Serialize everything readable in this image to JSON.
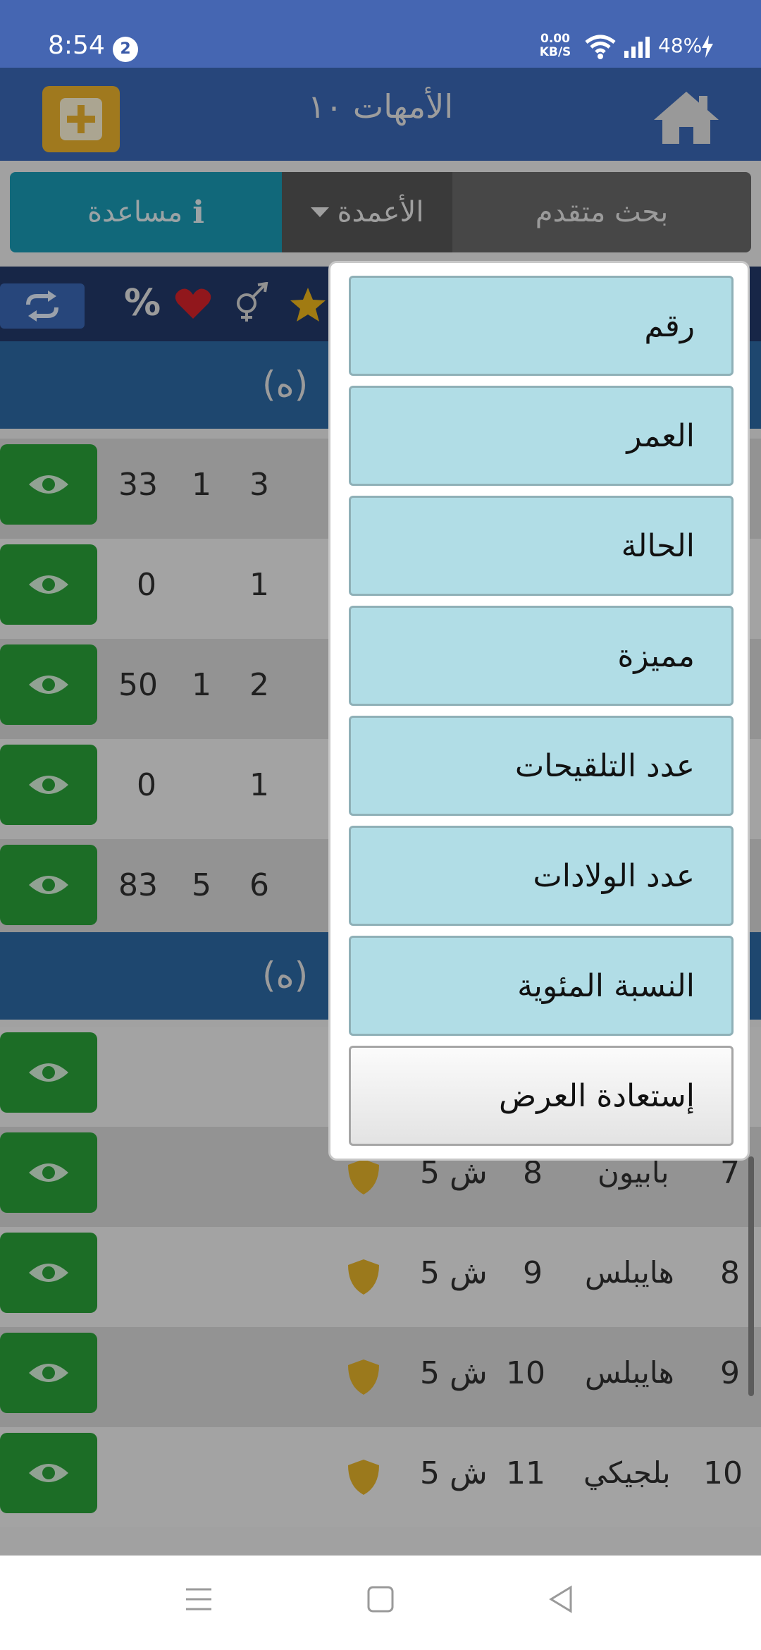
{
  "status_bar": {
    "time": "8:54",
    "notification_count": "2",
    "net_speed_value": "0.00",
    "net_speed_unit": "KB/S",
    "battery": "48%"
  },
  "app_bar": {
    "title": "الأمهات ١٠",
    "brand_color": "#3b69b8",
    "add_button_color": "#efb52e"
  },
  "toolbar": {
    "help_label": "مساعدة",
    "columns_label": "الأعمدة",
    "advanced_search_label": "بحث متقدم"
  },
  "filter_icons": [
    "refresh-icon",
    "percent-icon",
    "heart-icon",
    "gender-icon",
    "star-icon"
  ],
  "filter_labels": {
    "percent": "%"
  },
  "groups": [
    {
      "label": "(ه)"
    },
    {
      "label": "(ه)"
    }
  ],
  "rows_group1": [
    {
      "c1": "33",
      "c2": "1",
      "c3": "3"
    },
    {
      "c1": "0",
      "c2": "",
      "c3": "1"
    },
    {
      "c1": "50",
      "c2": "1",
      "c3": "2"
    },
    {
      "c1": "0",
      "c2": "",
      "c3": "1"
    },
    {
      "c1": "83",
      "c2": "5",
      "c3": "6"
    }
  ],
  "rows_group2": [
    {
      "num": "",
      "name": "",
      "age": "",
      "status": ""
    },
    {
      "num": "7",
      "name": "بابيون",
      "age": "8",
      "status": "5 ش"
    },
    {
      "num": "8",
      "name": "هايبلس",
      "age": "9",
      "status": "5 ش"
    },
    {
      "num": "9",
      "name": "هايبلس",
      "age": "10",
      "status": "5 ش"
    },
    {
      "num": "10",
      "name": "بلجيكي",
      "age": "11",
      "status": "5 ش"
    }
  ],
  "columns_menu": {
    "items": [
      "رقم",
      "العمر",
      "الحالة",
      "مميزة",
      "عدد التلقيحات",
      "عدد الولادات",
      "النسبة المئوية"
    ],
    "reset_label": "إستعادة العرض"
  },
  "nav_bar": [
    "menu-icon",
    "home-square-icon",
    "back-triangle-icon"
  ]
}
